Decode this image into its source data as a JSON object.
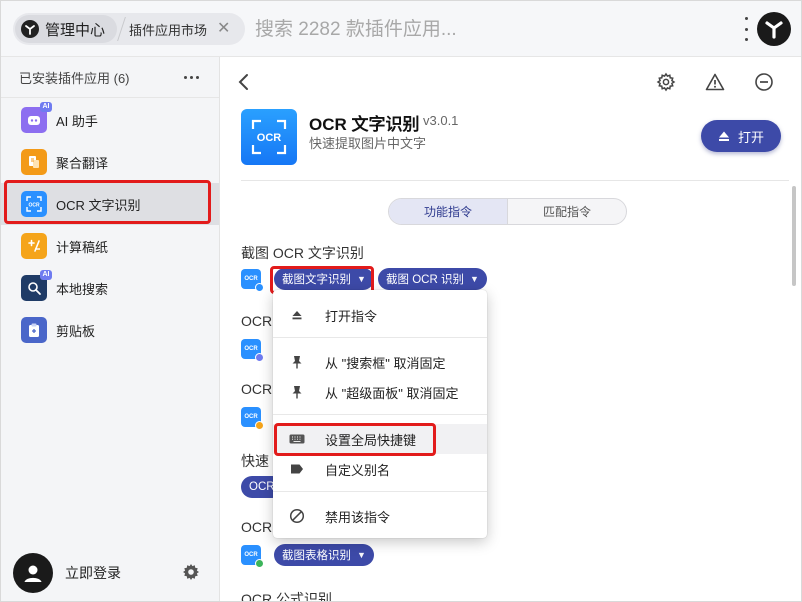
{
  "topbar": {
    "home_label": "管理中心",
    "market_label": "插件应用市场",
    "search_placeholder": "搜索 2282 款插件应用..."
  },
  "sidebar": {
    "header": "已安装插件应用 (6)",
    "items": [
      {
        "label": "AI 助手",
        "icon": "ai-assistant-icon"
      },
      {
        "label": "聚合翻译",
        "icon": "translate-icon"
      },
      {
        "label": "OCR 文字识别",
        "icon": "ocr-icon"
      },
      {
        "label": "计算稿纸",
        "icon": "calculator-icon"
      },
      {
        "label": "本地搜索",
        "icon": "local-search-icon"
      },
      {
        "label": "剪贴板",
        "icon": "clipboard-icon"
      }
    ],
    "login_label": "立即登录"
  },
  "plugin": {
    "icon_text": "OCR",
    "name": "OCR 文字识别",
    "version": "v3.0.1",
    "description": "快速提取图片中文字",
    "open_label": "打开"
  },
  "segmented": {
    "tab1": "功能指令",
    "tab2": "匹配指令"
  },
  "sections": [
    {
      "title": "截图 OCR 文字识别",
      "chips": [
        "截图文字识别",
        "截图 OCR 识别"
      ]
    },
    {
      "title": "OCR",
      "chips": []
    },
    {
      "title": "OCR",
      "chips": []
    },
    {
      "title": "快速",
      "chips": [
        "OCR"
      ]
    },
    {
      "title": "OCR",
      "chips": [
        "截图表格识别"
      ]
    },
    {
      "title": "OCR 公式识别",
      "chips": []
    }
  ],
  "menu": {
    "items": [
      {
        "label": "打开指令",
        "icon": "eject-icon"
      },
      {
        "label": "从 \"搜索框\" 取消固定",
        "icon": "pin-icon"
      },
      {
        "label": "从 \"超级面板\" 取消固定",
        "icon": "pin-icon"
      },
      {
        "label": "设置全局快捷键",
        "icon": "keyboard-icon"
      },
      {
        "label": "自定义别名",
        "icon": "tag-icon"
      },
      {
        "label": "禁用该指令",
        "icon": "disable-icon"
      }
    ]
  },
  "colors": {
    "accent": "#3d4aa8",
    "highlight": "#e21b1b",
    "ocr_blue": "#2a90ff"
  }
}
